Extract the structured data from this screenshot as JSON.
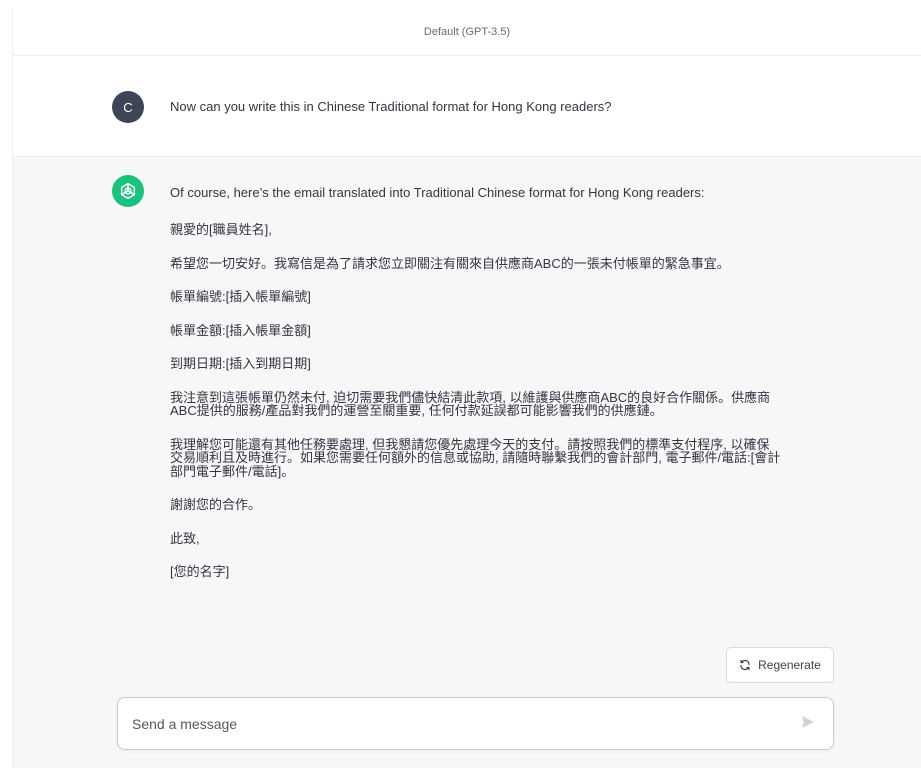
{
  "header": {
    "model_label": "Default (GPT-3.5)"
  },
  "user_message": {
    "avatar_initial": "C",
    "text": "Now can you write this in Chinese Traditional format for Hong Kong readers?"
  },
  "assistant_message": {
    "icon": "openai-logo-icon",
    "intro": "Of course, here’s the email translated into Traditional Chinese format for Hong Kong readers:",
    "paragraphs": [
      "親愛的[職員姓名],",
      "希望您一切安好。我寫信是為了請求您立即關注有關來自供應商ABC的一張未付帳單的緊急事宜。",
      "帳單編號:[插入帳單編號]",
      "帳單金額:[插入帳單金額]",
      "到期日期:[插入到期日期]",
      "我注意到這張帳單仍然未付, 迫切需要我們儘快結清此款項, 以維護與供應商ABC的良好合作關係。供應商ABC提供的服務/產品對我們的運營至關重要, 任何付款延誤都可能影響我們的供應鏈。",
      "我理解您可能還有其他任務要處理, 但我懇請您優先處理今天的支付。請按照我們的標準支付程序, 以確保交易順利且及時進行。如果您需要任何額外的信息或協助, 請隨時聯繫我們的會計部門, 電子郵件/電話:[會計部門電子郵件/電話]。",
      "謝謝您的合作。",
      "此致,",
      "[您的名字]"
    ]
  },
  "actions": {
    "regenerate_label": "Regenerate",
    "regenerate_icon": "refresh-icon"
  },
  "composer": {
    "placeholder": "Send a message",
    "value": "",
    "send_icon": "send-icon"
  },
  "colors": {
    "user_avatar": "#3c4656",
    "assistant_avatar": "#19c37d",
    "assistant_background": "#f7f7f8"
  }
}
